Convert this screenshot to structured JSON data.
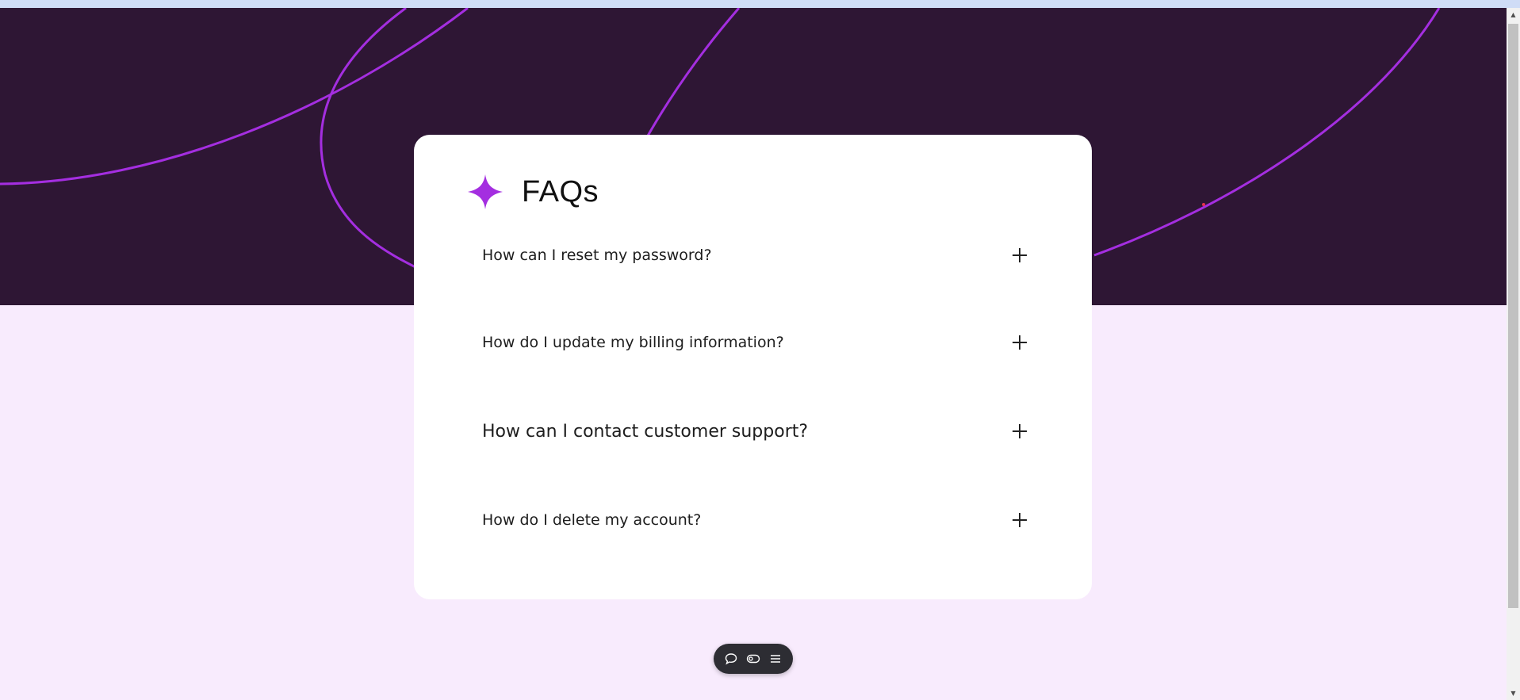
{
  "faq": {
    "title": "FAQs",
    "questions": [
      {
        "text": "How can I reset my password?",
        "icon": "plus-icon"
      },
      {
        "text": "How do I update my billing information?",
        "icon": "plus-icon"
      },
      {
        "text": "How can I contact customer support?",
        "icon": "plus-icon"
      },
      {
        "text": "How do I delete my account?",
        "icon": "plus-icon"
      }
    ]
  },
  "toolbar": {
    "buttons": [
      {
        "icon": "chat-bubble-icon"
      },
      {
        "icon": "toggle-icon"
      },
      {
        "icon": "menu-icon"
      }
    ]
  },
  "colors": {
    "hero_background": "#2e1634",
    "page_background": "#f8ebfd",
    "accent_purple": "#a42ee0",
    "card_background": "#ffffff",
    "toolbar_background": "#2d2d33"
  }
}
